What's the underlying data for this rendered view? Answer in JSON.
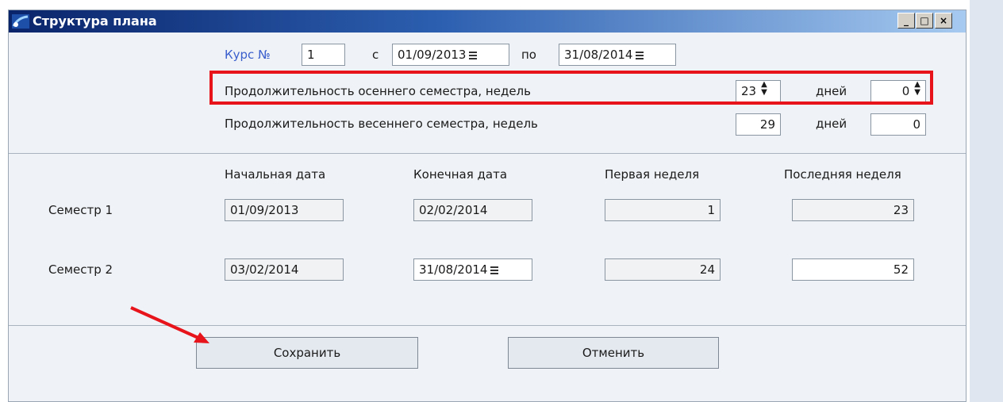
{
  "window": {
    "title": "Структура плана",
    "controls": [
      "_",
      "□",
      "×"
    ]
  },
  "header": {
    "course_label": "Курс №",
    "course_value": "1",
    "from_label": "с",
    "from_date": "01/09/2013",
    "to_label": "по",
    "to_date": "31/08/2014",
    "autumn_label": "Продолжительность осеннего семестра, недель",
    "autumn_weeks": "23",
    "autumn_days_label": "дней",
    "autumn_days": "0",
    "spring_label": "Продолжительность весеннего семестра, недель",
    "spring_weeks": "29",
    "spring_days_label": "дней",
    "spring_days": "0"
  },
  "table": {
    "columns": [
      "Начальная дата",
      "Конечная дата",
      "Первая неделя",
      "Последняя неделя"
    ],
    "rows": [
      {
        "label": "Семестр 1",
        "start": "01/09/2013",
        "end": "02/02/2014",
        "first_week": "1",
        "last_week": "23"
      },
      {
        "label": "Семестр 2",
        "start": "03/02/2014",
        "end": "31/08/2014",
        "first_week": "24",
        "last_week": "52"
      }
    ]
  },
  "footer": {
    "save_label": "Сохранить",
    "cancel_label": "Отменить"
  },
  "icons": {
    "calendar": "calendar-icon",
    "spinner": "spinner-icon",
    "window": "app-icon"
  },
  "annotation_color": "#e8141b"
}
